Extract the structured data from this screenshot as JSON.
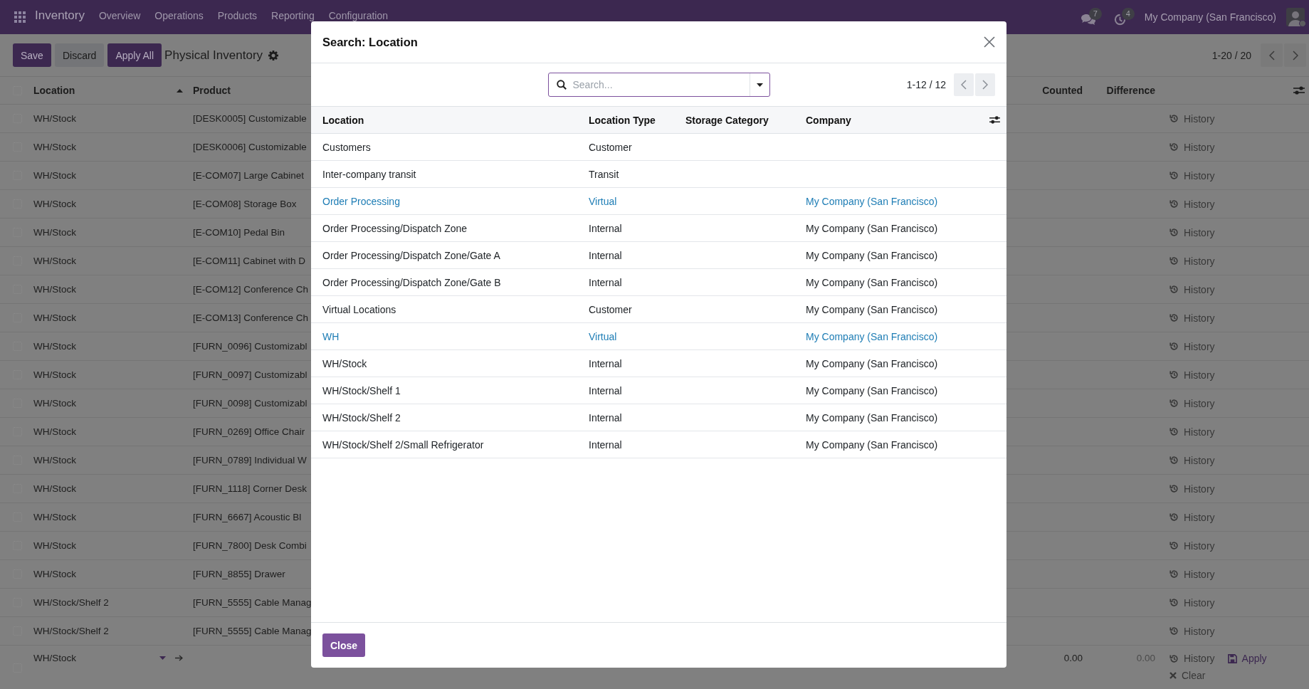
{
  "navbar": {
    "app_name": "Inventory",
    "menu": [
      "Overview",
      "Operations",
      "Products",
      "Reporting",
      "Configuration"
    ],
    "messages_count": "7",
    "activities_count": "4",
    "company": "My Company (San Francisco)"
  },
  "control_panel": {
    "buttons": [
      {
        "label": "Save",
        "kind": "primary"
      },
      {
        "label": "Discard",
        "kind": "secondary"
      },
      {
        "label": "Apply All",
        "kind": "primary"
      }
    ],
    "title": "Physical Inventory",
    "pager": "1-20 / 20"
  },
  "list": {
    "header_checked": false,
    "columns": [
      {
        "label": "Location",
        "sorted": true
      },
      {
        "label": "Product",
        "sorted": false
      },
      {
        "label": "Counted",
        "sorted": false
      },
      {
        "label": "Difference",
        "sorted": false
      }
    ],
    "rows": [
      {
        "location": "WH/Stock",
        "product": "[DESK0005] Customizable",
        "action": "History",
        "checked": false
      },
      {
        "location": "WH/Stock",
        "product": "[DESK0006] Customizable",
        "action": "History",
        "checked": false
      },
      {
        "location": "WH/Stock",
        "product": "[E-COM07] Large Cabinet",
        "action": "History",
        "checked": false
      },
      {
        "location": "WH/Stock",
        "product": "[E-COM08] Storage Box",
        "action": "History",
        "checked": false
      },
      {
        "location": "WH/Stock",
        "product": "[E-COM10] Pedal Bin",
        "action": "History",
        "checked": false
      },
      {
        "location": "WH/Stock",
        "product": "[E-COM11] Cabinet with D",
        "action": "History",
        "checked": false
      },
      {
        "location": "WH/Stock",
        "product": "[E-COM12] Conference Ch",
        "action": "History",
        "checked": false
      },
      {
        "location": "WH/Stock",
        "product": "[E-COM13] Conference Ch",
        "action": "History",
        "checked": false
      },
      {
        "location": "WH/Stock",
        "product": "[FURN_0096] Customizabl",
        "action": "History",
        "checked": false
      },
      {
        "location": "WH/Stock",
        "product": "[FURN_0097] Customizabl",
        "action": "History",
        "checked": false
      },
      {
        "location": "WH/Stock",
        "product": "[FURN_0098] Customizabl",
        "action": "History",
        "checked": false
      },
      {
        "location": "WH/Stock",
        "product": "[FURN_0269] Office Chair",
        "action": "History",
        "checked": false
      },
      {
        "location": "WH/Stock",
        "product": "[FURN_0789] Individual W",
        "action": "History",
        "checked": false
      },
      {
        "location": "WH/Stock",
        "product": "[FURN_1118] Corner Desk",
        "action": "History",
        "checked": false
      },
      {
        "location": "WH/Stock",
        "product": "[FURN_6667] Acoustic Bl",
        "action": "History",
        "checked": false
      },
      {
        "location": "WH/Stock",
        "product": "[FURN_7800] Desk Combi",
        "action": "History",
        "checked": false
      },
      {
        "location": "WH/Stock",
        "product": "[FURN_8855] Drawer",
        "action": "History",
        "checked": false
      },
      {
        "location": "WH/Stock/Shelf 2",
        "product": "[FURN_5555] Cable Manag",
        "action": "History",
        "checked": false
      },
      {
        "location": "WH/Stock/Shelf 2",
        "product": "[FURN_5555] Cable Manag",
        "action": "History",
        "checked": false
      }
    ],
    "edit_row": {
      "checked": false,
      "location": "WH/Stock",
      "counted": "0.00",
      "difference": "0.00",
      "actions": [
        {
          "label": "History",
          "kind": "history"
        },
        {
          "label": "Apply",
          "kind": "apply"
        },
        {
          "label": "Clear",
          "kind": "clear"
        }
      ]
    }
  },
  "dialog": {
    "title": "Search: Location",
    "search": {
      "placeholder": "Search..."
    },
    "pager": "1-12 / 12",
    "columns": [
      "Location",
      "Location Type",
      "Storage Category",
      "Company"
    ],
    "rows": [
      {
        "location": "Customers",
        "location_type": "Customer",
        "color": "#212529"
      },
      {
        "location": "Inter-company transit",
        "location_type": "Transit",
        "color": "#212529"
      },
      {
        "location": "Order Processing",
        "location_type": "Virtual",
        "company": "My Company (San Francisco)",
        "color": "#1e7db5"
      },
      {
        "location": "Order Processing/Dispatch Zone",
        "location_type": "Internal",
        "company": "My Company (San Francisco)",
        "color": "#212529"
      },
      {
        "location": "Order Processing/Dispatch Zone/Gate A",
        "location_type": "Internal",
        "company": "My Company (San Francisco)",
        "color": "#212529"
      },
      {
        "location": "Order Processing/Dispatch Zone/Gate B",
        "location_type": "Internal",
        "company": "My Company (San Francisco)",
        "color": "#212529"
      },
      {
        "location": "Virtual Locations",
        "location_type": "Customer",
        "company": "My Company (San Francisco)",
        "color": "#212529"
      },
      {
        "location": "WH",
        "location_type": "Virtual",
        "company": "My Company (San Francisco)",
        "color": "#1e7db5"
      },
      {
        "location": "WH/Stock",
        "location_type": "Internal",
        "company": "My Company (San Francisco)",
        "color": "#212529"
      },
      {
        "location": "WH/Stock/Shelf 1",
        "location_type": "Internal",
        "company": "My Company (San Francisco)",
        "color": "#212529"
      },
      {
        "location": "WH/Stock/Shelf 2",
        "location_type": "Internal",
        "company": "My Company (San Francisco)",
        "color": "#212529"
      },
      {
        "location": "WH/Stock/Shelf 2/Small Refrigerator",
        "location_type": "Internal",
        "company": "My Company (San Francisco)",
        "color": "#212529"
      }
    ],
    "buttons": [
      {
        "label": "Close",
        "kind": "primary"
      }
    ]
  }
}
